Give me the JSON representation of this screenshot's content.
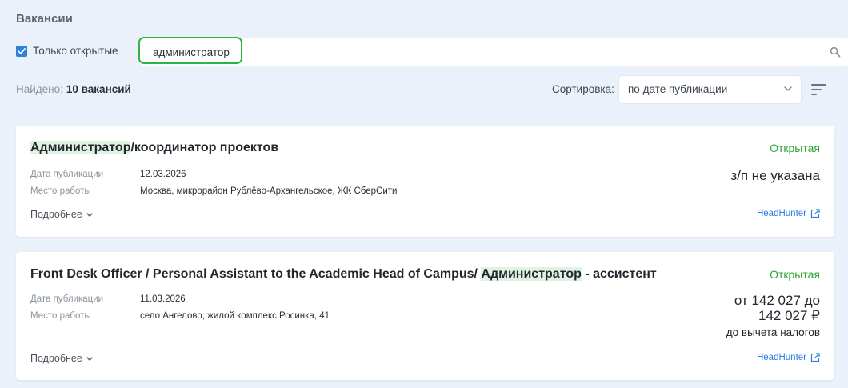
{
  "page": {
    "title": "Вакансии"
  },
  "filters": {
    "only_open_label": "Только открытые",
    "only_open_checked": true,
    "search_value": "администратор"
  },
  "results": {
    "found_label": "Найдено:",
    "found_count": "10 вакансий"
  },
  "sort": {
    "label": "Сортировка:",
    "value": "по дате публикации"
  },
  "vacancies": [
    {
      "title_highlight": "Администратор",
      "title_rest": "/координатор проектов",
      "status": "Открытая",
      "date_label": "Дата публикации",
      "date": "12.03.2026",
      "place_label": "Место работы",
      "place": "Москва, микрорайон Рублёво-Архангельское, ЖК СберСити",
      "salary": "з/п не указана",
      "more": "Подробнее",
      "source": "HeadHunter"
    },
    {
      "title_before": "Front Desk Officer / Personal Assistant to the Academic Head of Campus/ ",
      "title_highlight": "Администратор",
      "title_after": " - ассистент",
      "status": "Открытая",
      "date_label": "Дата публикации",
      "date": "11.03.2026",
      "place_label": "Место работы",
      "place": "село Ангелово, жилой комплекс Росинка, 41",
      "salary_line1": "от 142 027 до",
      "salary_line2": "142 027 ₽",
      "salary_note": "до вычета налогов",
      "more": "Подробнее",
      "source": "HeadHunter"
    }
  ],
  "colors": {
    "accent": "#2e80e0",
    "status_open": "#2fa63a",
    "highlight": "#dff3e3",
    "search_focus": "#2fb53f"
  }
}
